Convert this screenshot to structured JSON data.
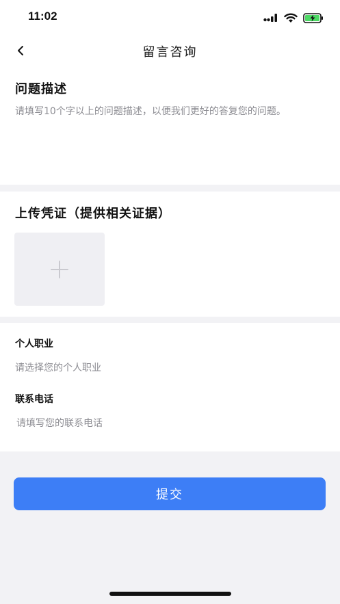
{
  "status_bar": {
    "time": "11:02",
    "icons": [
      "signal-icon",
      "wifi-icon",
      "battery-charging-icon"
    ],
    "battery_color": "#4cd964"
  },
  "nav": {
    "back_icon": "chevron-left-icon",
    "title": "留言咨询"
  },
  "description": {
    "title": "问题描述",
    "placeholder": "请填写10个字以上的问题描述，以便我们更好的答复您的问题。",
    "value": ""
  },
  "upload": {
    "title": "上传凭证（提供相关证据）",
    "add_icon": "plus-icon"
  },
  "fields": {
    "occupation": {
      "label": "个人职业",
      "placeholder": "请选择您的个人职业",
      "value": ""
    },
    "phone": {
      "label": "联系电话",
      "placeholder": "请填写您的联系电话",
      "value": ""
    }
  },
  "submit": {
    "label": "提交"
  },
  "colors": {
    "accent": "#3d7ef6",
    "page_background": "#f2f2f5",
    "placeholder_text": "#8d8d93",
    "upload_box": "#efeff3"
  }
}
